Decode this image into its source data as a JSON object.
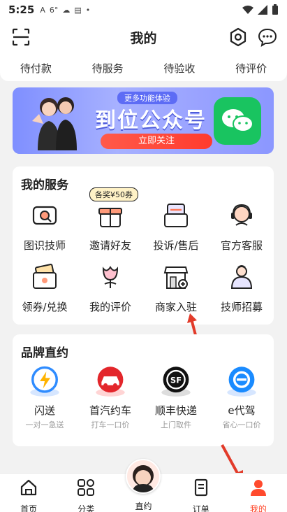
{
  "status": {
    "time": "5:25",
    "icons": [
      "A",
      "6°",
      "cloud",
      "app",
      "•"
    ]
  },
  "header": {
    "title": "我的"
  },
  "orders": [
    "待付款",
    "待服务",
    "待验收",
    "待评价"
  ],
  "banner": {
    "tag": "更多功能体验",
    "title": "到位公众号",
    "cta": "立即关注"
  },
  "services": {
    "title": "我的服务",
    "badge": "各奖¥50券",
    "items": [
      {
        "label": "图识技师",
        "icon": "image-search-icon"
      },
      {
        "label": "邀请好友",
        "icon": "gift-icon"
      },
      {
        "label": "投诉/售后",
        "icon": "complaint-icon"
      },
      {
        "label": "官方客服",
        "icon": "customer-service-icon"
      },
      {
        "label": "领券/兑换",
        "icon": "coupon-icon"
      },
      {
        "label": "我的评价",
        "icon": "flower-icon"
      },
      {
        "label": "商家入驻",
        "icon": "store-icon"
      },
      {
        "label": "技师招募",
        "icon": "recruit-icon"
      }
    ]
  },
  "brands": {
    "title": "品牌直约",
    "items": [
      {
        "label": "闪送",
        "sub": "一对一急送",
        "color": "#2f8cff"
      },
      {
        "label": "首汽约车",
        "sub": "打车一口价",
        "color": "#e3262b"
      },
      {
        "label": "顺丰快递",
        "sub": "上门取件",
        "color": "#111111"
      },
      {
        "label": "e代驾",
        "sub": "省心一口价",
        "color": "#1a8bff"
      }
    ]
  },
  "tabs": [
    {
      "label": "首页",
      "icon": "home-icon"
    },
    {
      "label": "分类",
      "icon": "grid-icon"
    },
    {
      "label": "直约",
      "icon": "avatar-icon"
    },
    {
      "label": "订单",
      "icon": "order-icon"
    },
    {
      "label": "我的",
      "icon": "me-icon"
    }
  ],
  "colors": {
    "accent": "#ff4a2d",
    "wechat": "#19c460",
    "banner": "#8b97ff"
  }
}
